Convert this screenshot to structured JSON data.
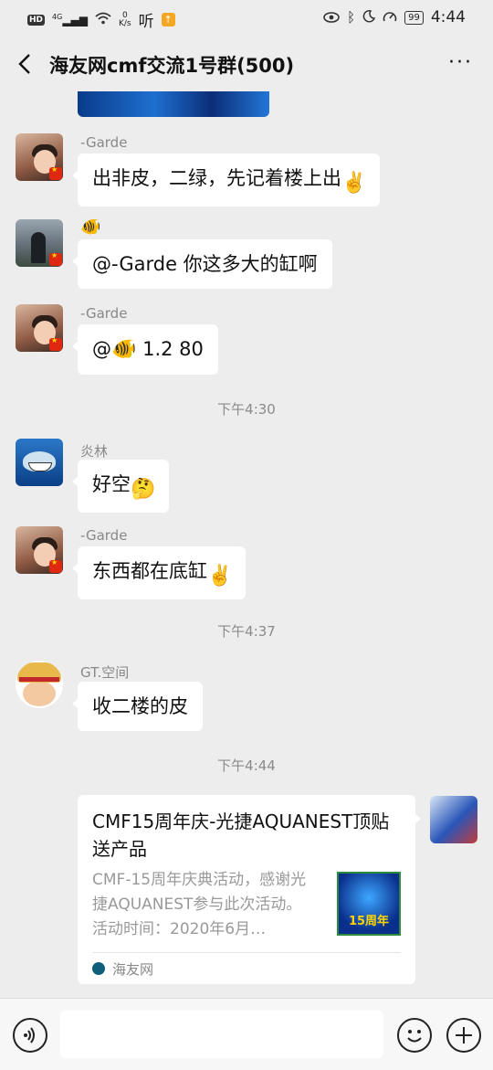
{
  "status_bar": {
    "hd_badge": "HD",
    "signal_label": "4G",
    "net_speed_value": "0",
    "net_speed_unit": "K/s",
    "ting_label": "听",
    "battery": "99",
    "time": "4:44"
  },
  "header": {
    "title": "海友网cmf交流1号群(500)",
    "more_label": "···"
  },
  "messages": [
    {
      "sender": "-Garde",
      "text": "出非皮，二绿，先记着楼上出",
      "emoji": "✌️"
    },
    {
      "sender": "🐠",
      "text": "@-Garde  你这多大的缸啊"
    },
    {
      "sender": "-Garde",
      "text_prefix": "@",
      "fish": "🐠",
      "text": " 1.2 80"
    },
    {
      "timestamp": "下午4:30"
    },
    {
      "sender": "炎林",
      "text": "好空",
      "emoji": "🤔"
    },
    {
      "sender": "-Garde",
      "text": "东西都在底缸",
      "emoji": "✌️"
    },
    {
      "timestamp": "下午4:37"
    },
    {
      "sender": "GT.空间",
      "text": "收二楼的皮"
    },
    {
      "timestamp": "下午4:44"
    }
  ],
  "link_card": {
    "title": "CMF15周年庆-光捷AQUANEST顶贴送产品",
    "description": "CMF-15周年庆典活动，感谢光捷AQUANEST参与此次活动。活动时间：2020年6月…",
    "thumb_text": "15周年",
    "source": "海友网"
  },
  "input_bar": {
    "placeholder": ""
  }
}
